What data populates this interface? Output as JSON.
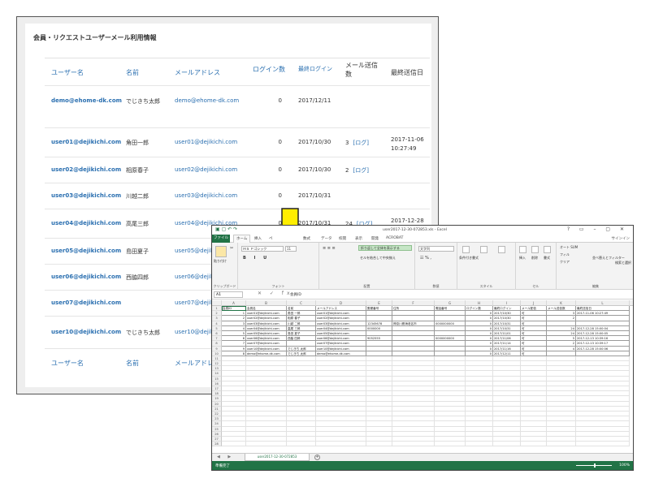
{
  "web": {
    "heading": "会員・リクエストユーザーメール利用情報",
    "headers": {
      "user": "ユーザー名",
      "name": "名前",
      "mail": "メールアドレス",
      "login_count": "ログイン数",
      "last_login": "最終ログイン",
      "mail_count_line1": "メール送信",
      "mail_count_line2": "数",
      "last_sent": "最終送信日"
    },
    "rows": [
      {
        "user": "demo@ehome-dk.com",
        "name": "でじきち太郎",
        "mail": "demo@ehome-dk.com",
        "login": "0",
        "last_login": "2017/12/11",
        "send": "",
        "log": "",
        "last_d": "",
        "last_t": ""
      },
      {
        "user": "user01@dejikichi.com",
        "name": "角田一郎",
        "mail": "user01@dejikichi.com",
        "login": "0",
        "last_login": "2017/10/30",
        "send": "3",
        "log": "[ログ]",
        "last_d": "2017-11-06",
        "last_t": "10:27:49"
      },
      {
        "user": "user02@dejikichi.com",
        "name": "相原春子",
        "mail": "user02@dejikichi.com",
        "login": "0",
        "last_login": "2017/10/30",
        "send": "2",
        "log": "[ログ]",
        "last_d": "",
        "last_t": ""
      },
      {
        "user": "user03@dejikichi.com",
        "name": "川越二郎",
        "mail": "user03@dejikichi.com",
        "login": "0",
        "last_login": "2017/10/31",
        "send": "",
        "log": "",
        "last_d": "",
        "last_t": ""
      },
      {
        "user": "user04@dejikichi.com",
        "name": "高尾三郎",
        "mail": "user04@dejikichi.com",
        "login": "0",
        "last_login": "2017/10/31",
        "send": "24",
        "log": "[ログ]",
        "last_d": "2017-12-28",
        "last_t": "15:00:04"
      },
      {
        "user": "user05@dejikichi.com",
        "name": "島田夏子",
        "mail": "user05@dejikichi.com",
        "login": "",
        "last_login": "",
        "send": "",
        "log": "",
        "last_d": "",
        "last_t": ""
      },
      {
        "user": "user06@dejikichi.com",
        "name": "西脇四郎",
        "mail": "user06@dejikichi.com",
        "login": "",
        "last_login": "",
        "send": "",
        "log": "",
        "last_d": "",
        "last_t": ""
      },
      {
        "user": "user07@dejikichi.com",
        "name": "",
        "mail": "user07@dejikichi.com",
        "login": "",
        "last_login": "",
        "send": "",
        "log": "",
        "last_d": "",
        "last_t": ""
      },
      {
        "user": "user10@dejikichi.com",
        "name": "でじきち太郎",
        "mail": "user10@dejikichi.com",
        "login": "",
        "last_login": "",
        "send": "",
        "log": "",
        "last_d": "",
        "last_t": ""
      }
    ]
  },
  "arrow_color": "#ffee00",
  "excel": {
    "title": "user2017-12-30-072853.xls - Excel",
    "window_controls": "? ▭ – ▢ ✕",
    "tabs": {
      "file": "ファイル",
      "home": "ホーム",
      "insert": "挿入",
      "page": "ペ",
      "formula": "数式",
      "data": "データ",
      "review": "校閲",
      "view": "表示",
      "dev": "開発",
      "acrobat": "ACROBAT",
      "signin": "サインイン"
    },
    "ribbon": {
      "paste": "貼り付け",
      "font_name": "ＭＳ Ｐゴシック",
      "font_size": "11",
      "wrap": "折り返して全体を表示する",
      "merge": "セルを結合して中央揃え",
      "number_format": "文字列",
      "cond": "条件付き書式",
      "table": "テーブルとして書式設定",
      "cellstyle": "セルのスタイル",
      "insert": "挿入",
      "delete": "削除",
      "format": "書式",
      "autosum": "オート SUM",
      "fill": "フィル",
      "clear": "クリア",
      "sort": "並べ替えとフィルター",
      "find": "検索と選択",
      "g_clipboard": "クリップボード",
      "g_font": "フォント",
      "g_align": "配置",
      "g_number": "数値",
      "g_style": "スタイル",
      "g_cells": "セル",
      "g_edit": "編集"
    },
    "name_box": "A1",
    "formula_symbols": "✕ ✓ fx",
    "formula_value": "会員ID",
    "col_letters": [
      "A",
      "B",
      "C",
      "D",
      "E",
      "F",
      "G",
      "H",
      "I",
      "J",
      "K",
      "L"
    ],
    "grid": [
      [
        "会員ID",
        "会員名",
        "名前",
        "メールアドレス",
        "郵便番号",
        "住所",
        "電話番号",
        "ログイン数",
        "最終ログイン",
        "メール配信",
        "メール送信数",
        "最終送信日"
      ],
      [
        "1",
        "user01@dejikichi.com",
        "角田 一郎",
        "user01@dejikichi.com",
        "",
        "",
        "",
        "0",
        "2017/10/30",
        "可",
        "3",
        "2017-11-06 10:27:49"
      ],
      [
        "2",
        "user02@dejikichi.com",
        "相原 春子",
        "user02@dejikichi.com",
        "",
        "",
        "",
        "0",
        "2017/10/30",
        "可",
        "2",
        ""
      ],
      [
        "3",
        "user03@dejikichi.com",
        "川越 二郎",
        "user03@dejikichi.com",
        "12345678",
        "神奈川県海老名市",
        "0000000000",
        "0",
        "2017/10/31",
        "可",
        "",
        ""
      ],
      [
        "4",
        "user04@dejikichi.com",
        "高尾 三郎",
        "user04@dejikichi.com",
        "0000000",
        "",
        "",
        "0",
        "2017/10/31",
        "可",
        "24",
        "2017-12-28 15:00:04"
      ],
      [
        "5",
        "user05@dejikichi.com",
        "島田 夏子",
        "user05@dejikichi.com",
        "",
        "",
        "",
        "0",
        "2017/11/01",
        "可",
        "24",
        "2017-12-28 15:00:05"
      ],
      [
        "6",
        "user06@dejikichi.com",
        "西脇 四郎",
        "user06@dejikichi.com",
        "9052555",
        "",
        "0000000000",
        "0",
        "2017/11/06",
        "可",
        "5",
        "2017-12-13 10:39:16"
      ],
      [
        "7",
        "user07@dejikichi.com",
        "",
        "user07@dejikichi.com",
        "",
        "",
        "",
        "0",
        "2017/11/14",
        "可",
        "2",
        "2017-12-13 10:39:17"
      ],
      [
        "9",
        "user10@dejikichi.com",
        "でじきち 太郎",
        "user10@dejikichi.com",
        "",
        "",
        "",
        "0",
        "2017/11/16",
        "可",
        "4",
        "2017-12-28 15:00:06"
      ],
      [
        "8",
        "demo@ehome-dk.com",
        "でじきち 太郎",
        "demo@ehome-dk.com",
        "",
        "",
        "",
        "0",
        "2017/12/11",
        "可",
        "",
        ""
      ]
    ],
    "sheet_tab": "user2017-12-30-072853",
    "status": "準備完了",
    "zoom": "100%"
  }
}
